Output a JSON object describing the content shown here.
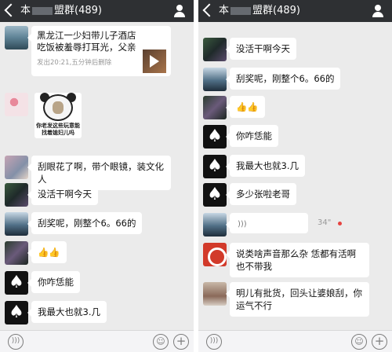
{
  "left": {
    "title": "本",
    "title_tail": "盟群(489)",
    "messages": [
      {
        "card_text": "黑龙江一少妇带儿子酒店吃饭被羞辱打耳光，父亲赶来后场面激...",
        "card_sub": "发出20:21,五分钟后删除"
      },
      {
        "sticker_caption": "你老发这些玩意能找着媳妇儿吗"
      },
      {
        "text": "刮眼花了啊，带个眼镜，装文化人"
      },
      {
        "text": "没活干啊今天"
      },
      {
        "text": "刮奖呢，刚整个6。66的"
      },
      {
        "text": "👍👍"
      },
      {
        "text": "你咋恁能"
      },
      {
        "text": "我最大也就3.几"
      }
    ]
  },
  "right": {
    "title": "本",
    "title_tail": "盟群(489)",
    "messages": [
      {
        "text": "没活干啊今天"
      },
      {
        "text": "刮奖呢，刚整个6。66的"
      },
      {
        "text": "👍👍"
      },
      {
        "text": "你咋恁能"
      },
      {
        "text": "我最大也就3.几"
      },
      {
        "text": "多少张啦老哥"
      },
      {
        "voice_len": "34\""
      },
      {
        "text": "说类啥声音那么杂 恁都有活啊也不带我"
      },
      {
        "text": "明儿有批货，回头让婆娘刮，你运气不行"
      }
    ]
  },
  "icons": {
    "back": "chevron-left-icon",
    "group": "person-icon",
    "voice": "voice-icon",
    "emoji": "emoji-icon",
    "plus": "plus-icon",
    "spade": "spade-icon",
    "play": "play-icon"
  },
  "colors": {
    "topbar": "#2e3033",
    "chat_bg": "#ebebeb",
    "bubble": "#ffffff",
    "unread": "#e64340"
  }
}
